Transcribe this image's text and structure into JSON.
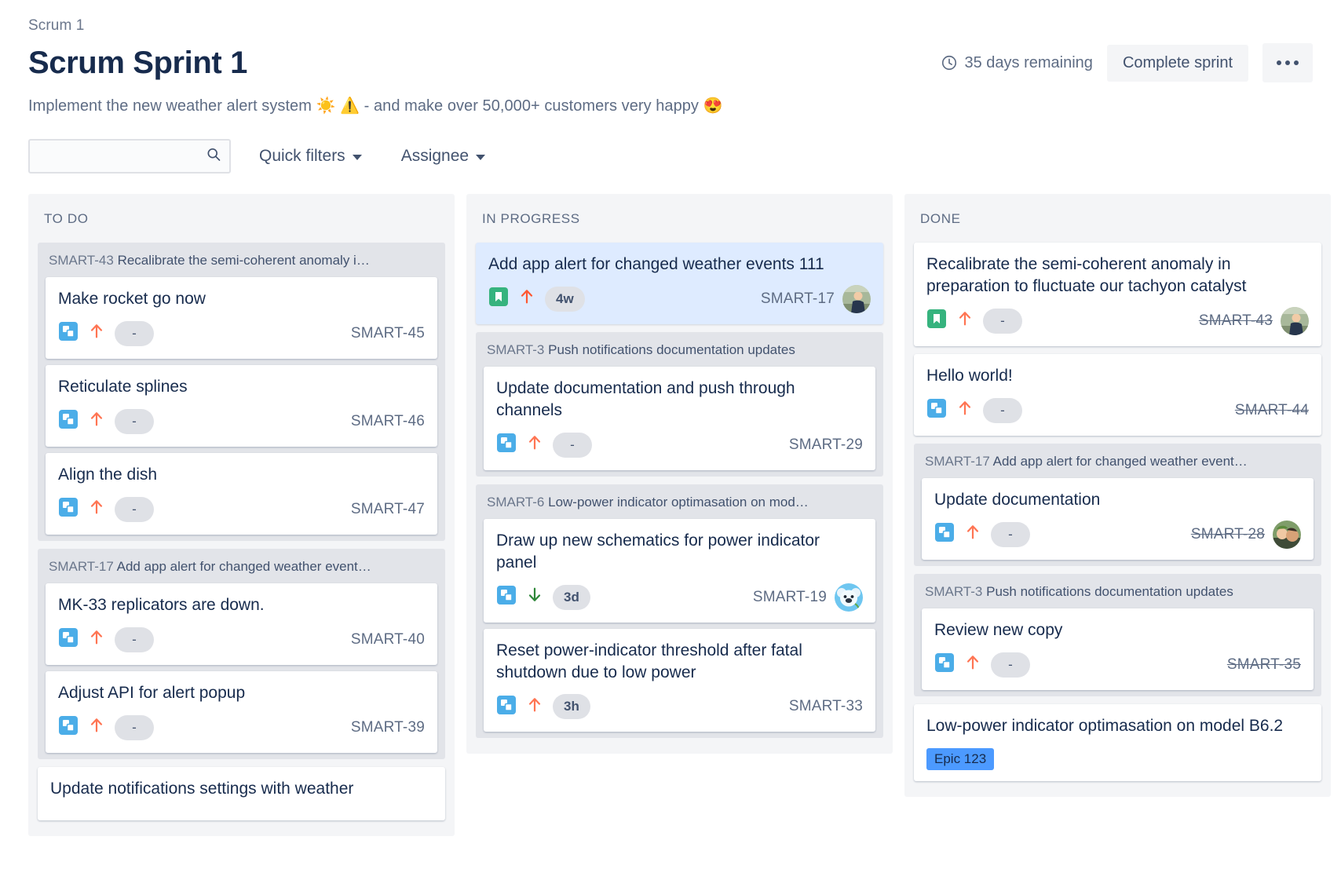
{
  "header": {
    "breadcrumb": "Scrum 1",
    "title": "Scrum Sprint 1",
    "subtitle": "Implement the new weather alert system ☀️ ⚠️  - and make over 50,000+ customers very happy 😍",
    "days_remaining": "35 days remaining",
    "clock_icon": "clock-icon",
    "complete_sprint_label": "Complete sprint",
    "more_actions_icon": "ellipsis-icon"
  },
  "filters": {
    "search_value": "",
    "search_placeholder": "",
    "search_icon": "search-icon",
    "quick_filters_label": "Quick filters",
    "assignee_label": "Assignee",
    "caret_icon": "chevron-down-icon"
  },
  "colors": {
    "selected_card": "#deebff",
    "subtask_icon": "#4bade8",
    "story_icon": "#36b37e",
    "priority_medium": "#ff7452",
    "priority_highest": "#ff5630",
    "priority_low": "#2d8738",
    "epic_badge": "#4c9aff",
    "column_bg": "#f4f5f7",
    "group_bg": "#e2e4e9"
  },
  "columns": [
    {
      "name": "TO DO",
      "groups": [
        {
          "type": "group",
          "key": "SMART-43",
          "summary": "Recalibrate the semi-coherent anomaly i…",
          "cards": [
            {
              "title": "Make rocket go now",
              "type_icon": "subtask-icon",
              "priority_icon": "priority-medium-icon",
              "estimate": "-",
              "key": "SMART-45",
              "done": false,
              "avatar": null
            },
            {
              "title": "Reticulate splines",
              "type_icon": "subtask-icon",
              "priority_icon": "priority-medium-icon",
              "estimate": "-",
              "key": "SMART-46",
              "done": false,
              "avatar": null
            },
            {
              "title": "Align the dish",
              "type_icon": "subtask-icon",
              "priority_icon": "priority-medium-icon",
              "estimate": "-",
              "key": "SMART-47",
              "done": false,
              "avatar": null
            }
          ]
        },
        {
          "type": "group",
          "key": "SMART-17",
          "summary": "Add app alert for changed weather event…",
          "cards": [
            {
              "title": "MK-33 replicators are down.",
              "type_icon": "subtask-icon",
              "priority_icon": "priority-medium-icon",
              "estimate": "-",
              "key": "SMART-40",
              "done": false,
              "avatar": null
            },
            {
              "title": "Adjust API for alert popup",
              "type_icon": "subtask-icon",
              "priority_icon": "priority-medium-icon",
              "estimate": "-",
              "key": "SMART-39",
              "done": false,
              "avatar": null
            }
          ]
        },
        {
          "type": "card",
          "card": {
            "title": "Update notifications settings with weather",
            "type_icon": null,
            "priority_icon": null,
            "estimate": null,
            "key": null,
            "done": false,
            "avatar": null
          }
        }
      ]
    },
    {
      "name": "IN PROGRESS",
      "groups": [
        {
          "type": "card",
          "card": {
            "title": "Add app alert for changed weather events 111",
            "type_icon": "story-icon",
            "priority_icon": "priority-highest-icon",
            "estimate": "4w",
            "key": "SMART-17",
            "done": false,
            "avatar": "photo-person",
            "selected": true
          }
        },
        {
          "type": "group",
          "key": "SMART-3",
          "summary": "Push notifications documentation updates",
          "cards": [
            {
              "title": "Update documentation and push through channels",
              "type_icon": "subtask-icon",
              "priority_icon": "priority-medium-icon",
              "estimate": "-",
              "key": "SMART-29",
              "done": false,
              "avatar": null
            }
          ]
        },
        {
          "type": "group",
          "key": "SMART-6",
          "summary": "Low-power indicator optimasation on mod…",
          "cards": [
            {
              "title": "Draw up new schematics for power indicator panel",
              "type_icon": "subtask-icon",
              "priority_icon": "priority-low-icon",
              "estimate": "3d",
              "key": "SMART-19",
              "done": false,
              "avatar": "koala-avatar"
            },
            {
              "title": "Reset power-indicator threshold after fatal shutdown due to low power",
              "type_icon": "subtask-icon",
              "priority_icon": "priority-medium-icon",
              "estimate": "3h",
              "key": "SMART-33",
              "done": false,
              "avatar": null
            }
          ]
        }
      ]
    },
    {
      "name": "DONE",
      "groups": [
        {
          "type": "card",
          "card": {
            "title": "Recalibrate the semi-coherent anomaly in preparation to fluctuate our tachyon catalyst",
            "type_icon": "story-icon",
            "priority_icon": "priority-medium-icon",
            "estimate": "-",
            "key": "SMART-43",
            "done": true,
            "avatar": "photo-person"
          }
        },
        {
          "type": "card",
          "card": {
            "title": "Hello world!",
            "type_icon": "subtask-icon",
            "priority_icon": "priority-medium-icon",
            "estimate": "-",
            "key": "SMART-44",
            "done": true,
            "avatar": null
          }
        },
        {
          "type": "group",
          "key": "SMART-17",
          "summary": "Add app alert for changed weather event…",
          "cards": [
            {
              "title": "Update documentation",
              "type_icon": "subtask-icon",
              "priority_icon": "priority-medium-icon",
              "estimate": "-",
              "key": "SMART-28",
              "done": true,
              "avatar": "photo-family"
            }
          ]
        },
        {
          "type": "group",
          "key": "SMART-3",
          "summary": "Push notifications documentation updates",
          "cards": [
            {
              "title": "Review new copy",
              "type_icon": "subtask-icon",
              "priority_icon": "priority-medium-icon",
              "estimate": "-",
              "key": "SMART-35",
              "done": true,
              "avatar": null
            }
          ]
        },
        {
          "type": "card",
          "card": {
            "title": "Low-power indicator optimasation on model B6.2",
            "type_icon": null,
            "priority_icon": null,
            "estimate": null,
            "key": null,
            "done": false,
            "avatar": null,
            "epic": "Epic 123"
          }
        }
      ]
    }
  ]
}
